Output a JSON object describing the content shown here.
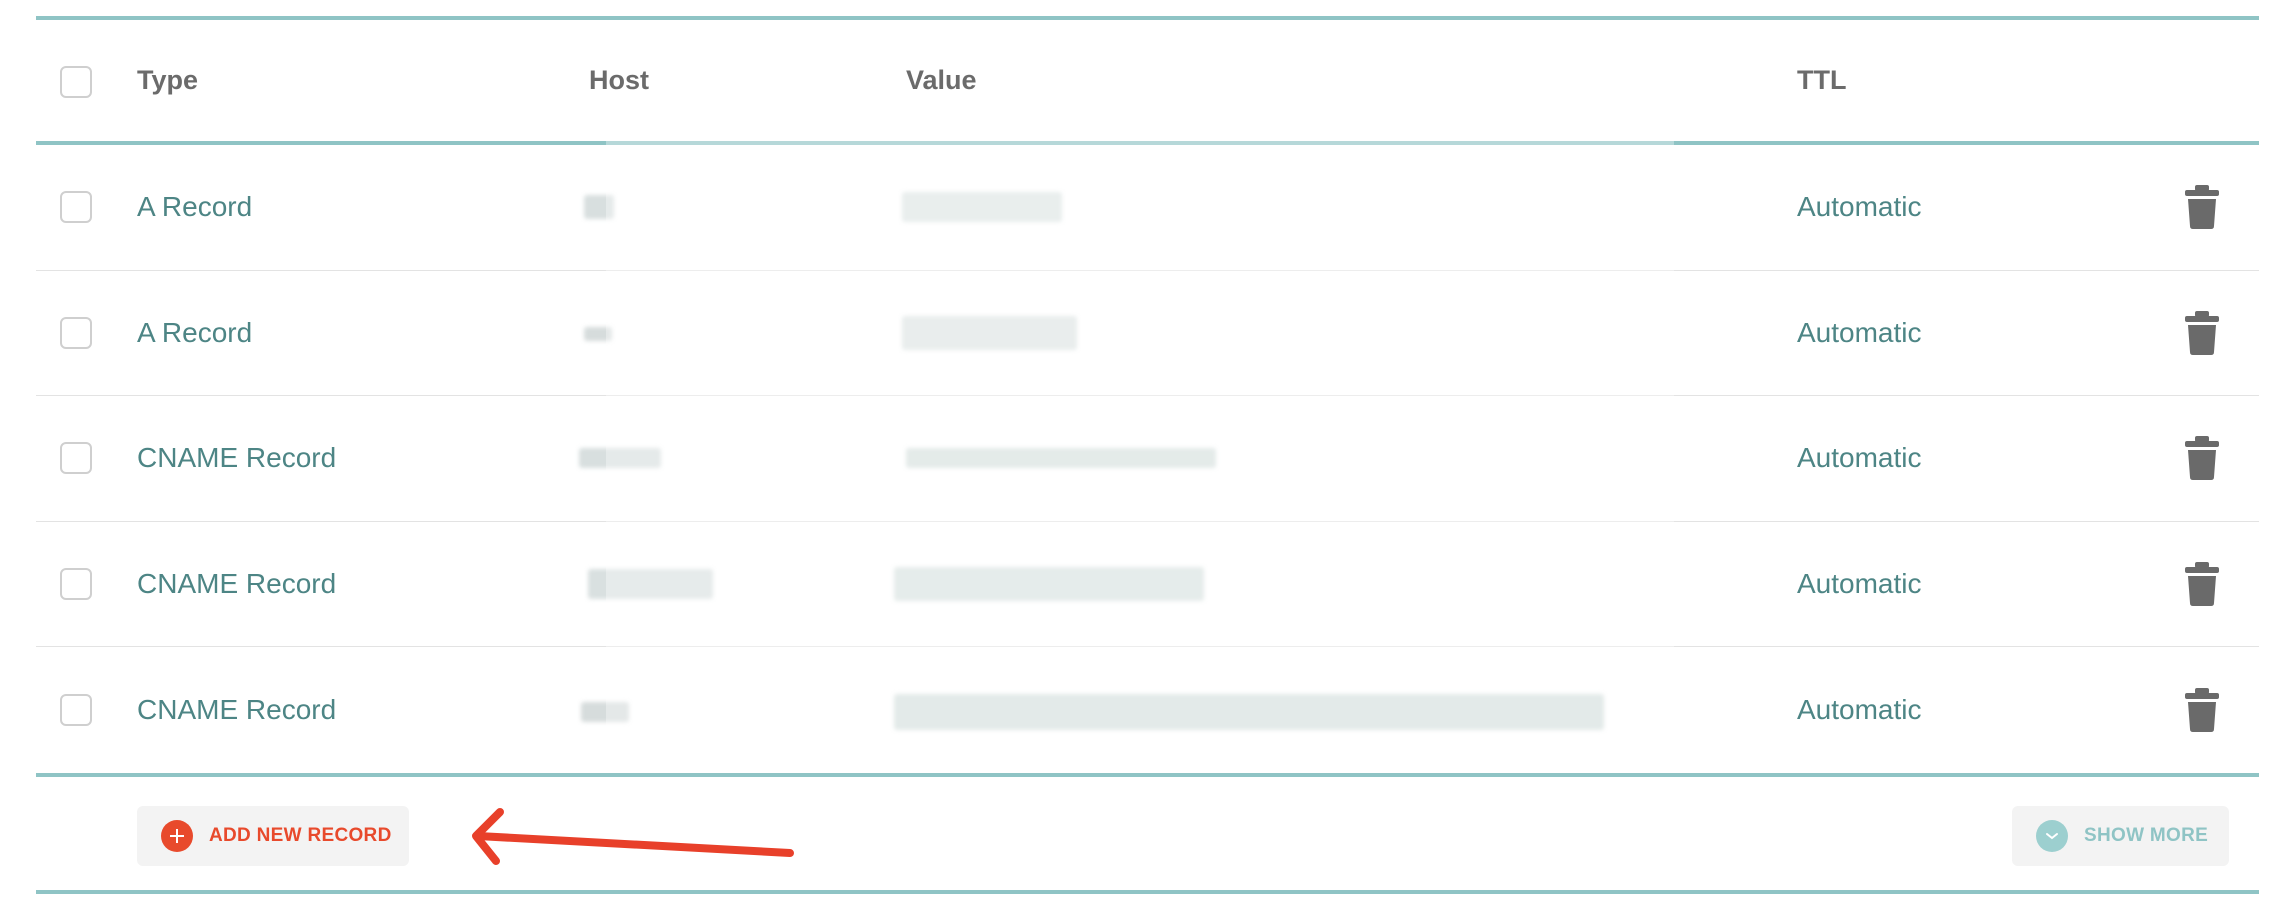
{
  "columns": {
    "type": "Type",
    "host": "Host",
    "value": "Value",
    "ttl": "TTL"
  },
  "records": [
    {
      "type": "A Record",
      "ttl": "Automatic"
    },
    {
      "type": "A Record",
      "ttl": "Automatic"
    },
    {
      "type": "CNAME Record",
      "ttl": "Automatic"
    },
    {
      "type": "CNAME Record",
      "ttl": "Automatic"
    },
    {
      "type": "CNAME Record",
      "ttl": "Automatic"
    }
  ],
  "actions": {
    "add_new_record": "ADD NEW RECORD",
    "show_more": "SHOW MORE"
  },
  "icons": {
    "row_delete": "trash-icon",
    "add": "plus-circle-icon",
    "show_more": "chevron-down-circle-icon",
    "annotation": "red-arrow-annotation"
  },
  "colors": {
    "accent_teal": "#8fc4c5",
    "record_text": "#4d8585",
    "add_red": "#e84a2c",
    "annotation_arrow": "#e8402a"
  }
}
